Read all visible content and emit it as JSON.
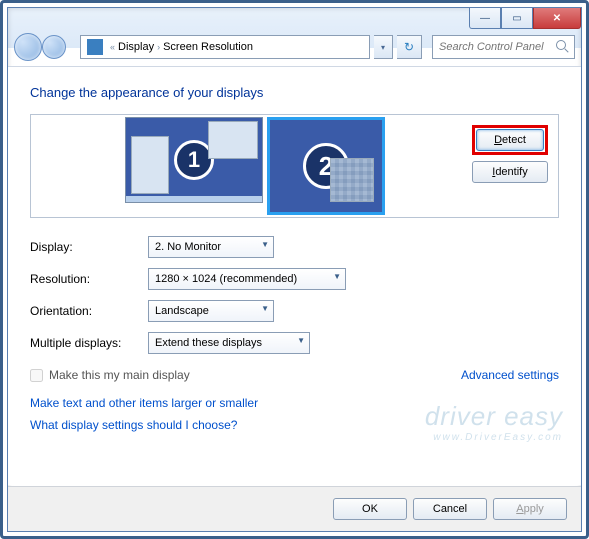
{
  "titlebar": {
    "min_tip": "Minimize",
    "max_tip": "Maximize",
    "close_tip": "Close"
  },
  "nav": {
    "breadcrumb_root": "Display",
    "breadcrumb_leaf": "Screen Resolution",
    "search_placeholder": "Search Control Panel"
  },
  "heading": "Change the appearance of your displays",
  "monitors": {
    "m1_label": "1",
    "m2_label": "2"
  },
  "buttons": {
    "detect": "Detect",
    "identify": "Identify",
    "ok": "OK",
    "cancel": "Cancel",
    "apply": "Apply"
  },
  "form": {
    "display_label": "Display:",
    "display_value": "2. No Monitor",
    "resolution_label": "Resolution:",
    "resolution_value": "1280 × 1024 (recommended)",
    "orientation_label": "Orientation:",
    "orientation_value": "Landscape",
    "multiple_label": "Multiple displays:",
    "multiple_value": "Extend these displays"
  },
  "checkbox_label": "Make this my main display",
  "advanced_link": "Advanced settings",
  "links": {
    "text_size": "Make text and other items larger or smaller",
    "help": "What display settings should I choose?"
  },
  "watermark": {
    "brand": "driver easy",
    "url": "www.DriverEasy.com"
  },
  "glyphs": {
    "chevrons": "«",
    "chev_right": "›",
    "dropdown": "▾",
    "refresh": "↻",
    "min": "—",
    "max": "▭",
    "close": "✕"
  }
}
